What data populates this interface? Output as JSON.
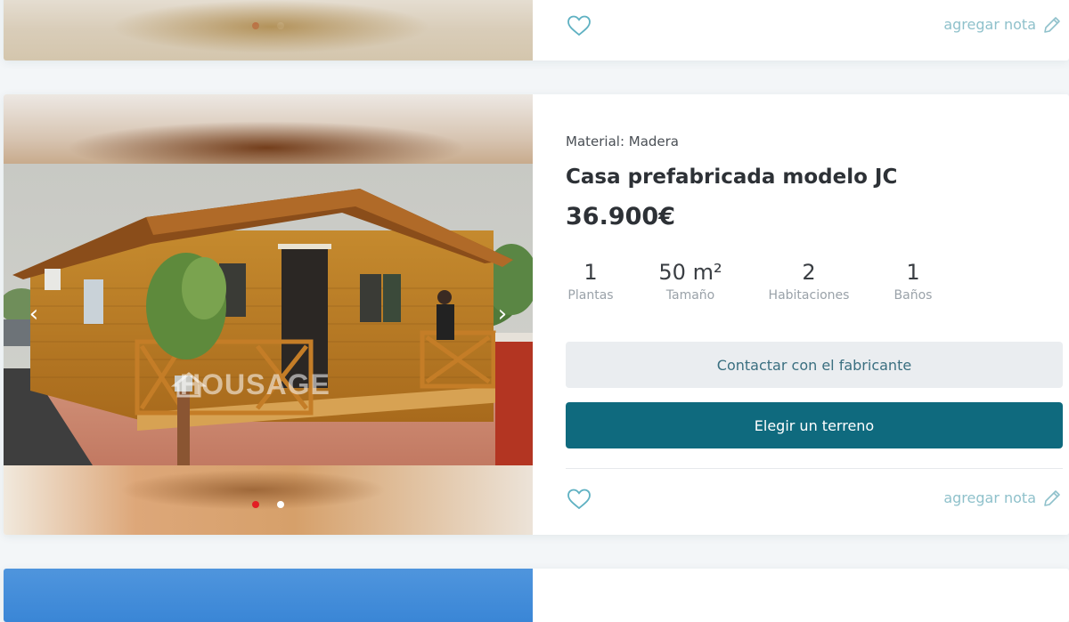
{
  "listings": [
    {
      "actions": {
        "note_label": "agregar nota",
        "favorite_icon": "heart-icon",
        "edit_icon": "pencil-icon"
      },
      "carousel": {
        "dots": 2,
        "active_dot": 0
      }
    },
    {
      "material": "Material: Madera",
      "title": "Casa prefabricada modelo JC",
      "price": "36.900€",
      "watermark": "HOUSAGE",
      "carousel": {
        "dots": 2,
        "active_dot": 0,
        "prev_icon": "chevron-left-icon",
        "next_icon": "chevron-right-icon",
        "prev_glyph": "‹",
        "next_glyph": "›"
      },
      "features": [
        {
          "value": "1",
          "label": "Plantas"
        },
        {
          "value": "50 m²",
          "label": "Tamaño"
        },
        {
          "value": "2",
          "label": "Habitaciones"
        },
        {
          "value": "1",
          "label": "Baños"
        }
      ],
      "buttons": {
        "contact": "Contactar con el fabricante",
        "terrain": "Elegir un terreno"
      },
      "actions": {
        "note_label": "agregar nota",
        "favorite_icon": "heart-icon",
        "edit_icon": "pencil-icon"
      }
    }
  ],
  "colors": {
    "primary": "#0f6a7e",
    "secondary_button": "#eaedf0",
    "secondary_text": "#3a6f80",
    "accent_link": "#8fc1cb",
    "active_dot": "#e31e24"
  }
}
